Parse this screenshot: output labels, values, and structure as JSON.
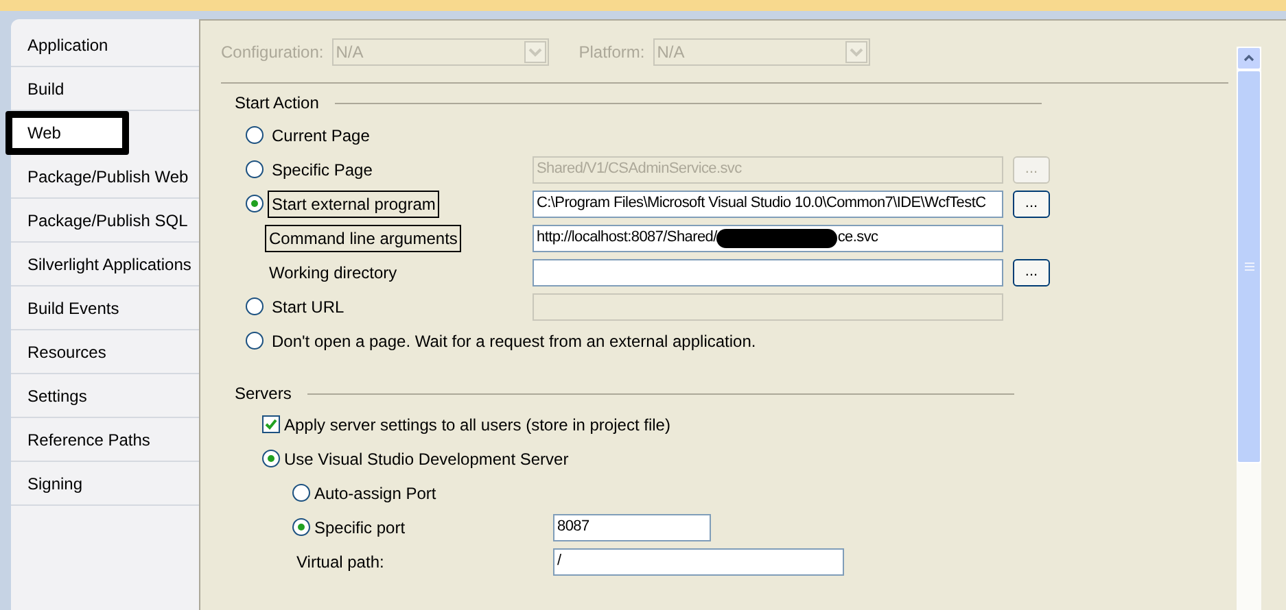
{
  "sidebar": {
    "items": [
      {
        "label": "Application",
        "selected": false
      },
      {
        "label": "Build",
        "selected": false
      },
      {
        "label": "Web",
        "selected": true
      },
      {
        "label": "Package/Publish Web",
        "selected": false
      },
      {
        "label": "Package/Publish SQL",
        "selected": false
      },
      {
        "label": "Silverlight Applications",
        "selected": false
      },
      {
        "label": "Build Events",
        "selected": false
      },
      {
        "label": "Resources",
        "selected": false
      },
      {
        "label": "Settings",
        "selected": false
      },
      {
        "label": "Reference Paths",
        "selected": false
      },
      {
        "label": "Signing",
        "selected": false
      }
    ]
  },
  "toolbar": {
    "configuration": {
      "label": "Configuration:",
      "value": "N/A",
      "disabled": true
    },
    "platform": {
      "label": "Platform:",
      "value": "N/A",
      "disabled": true
    }
  },
  "start_action": {
    "title": "Start Action",
    "rows": [
      {
        "kind": "radio",
        "label": "Current Page",
        "selected": false
      },
      {
        "kind": "radio",
        "label": "Specific Page",
        "selected": false,
        "field": {
          "value": "Shared/V1/CSAdminService.svc",
          "disabled": true
        },
        "browse": {
          "label": "...",
          "disabled": true
        }
      },
      {
        "kind": "radio",
        "label": "Start external program",
        "selected": true,
        "outlined": true,
        "field": {
          "value": "C:\\Program Files\\Microsoft Visual Studio 10.0\\Common7\\IDE\\WcfTestC",
          "disabled": false
        },
        "browse": {
          "label": "...",
          "disabled": false
        }
      },
      {
        "kind": "label",
        "label": "Command line arguments",
        "outlined": true,
        "field": {
          "value": "http://localhost:8087/Shared/",
          "value_end": "ce.svc",
          "redacted": true,
          "disabled": false
        }
      },
      {
        "kind": "label",
        "label": "Working directory",
        "outlined": false,
        "field": {
          "disabled": false
        },
        "browse": {
          "label": "...",
          "disabled": false
        }
      },
      {
        "kind": "radio",
        "label": "Start URL",
        "selected": false,
        "field": {
          "disabled": true
        }
      },
      {
        "kind": "radio",
        "label": "Don't open a page.  Wait for a request from an external application.",
        "selected": false
      }
    ]
  },
  "servers": {
    "title": "Servers",
    "rows": [
      {
        "kind": "checkbox",
        "label": "Apply server settings to all users (store in project file)",
        "checked": true,
        "indent": false
      },
      {
        "kind": "radio",
        "label": "Use Visual Studio Development Server",
        "selected": true,
        "indent": false
      },
      {
        "kind": "radio",
        "label": "Auto-assign Port",
        "selected": false,
        "indent": true
      },
      {
        "kind": "radio",
        "label": "Specific port",
        "selected": true,
        "indent": true,
        "field": {
          "value": "8087",
          "disabled": false
        }
      },
      {
        "kind": "label",
        "label": "Virtual path:",
        "indent": true,
        "field": {
          "value": "/",
          "disabled": false
        }
      }
    ]
  }
}
